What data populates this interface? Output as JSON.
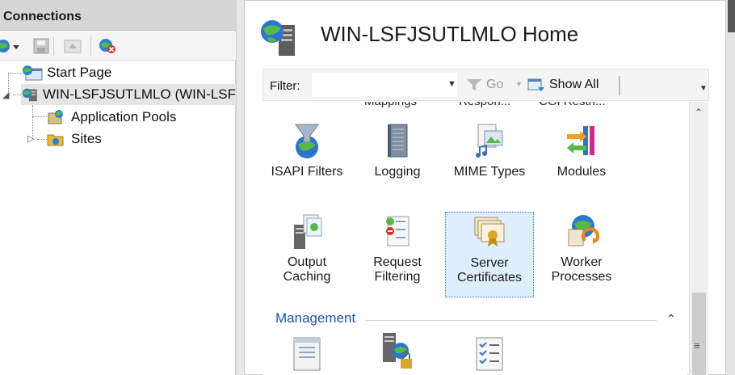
{
  "connections": {
    "header": "Connections",
    "tree": {
      "start_page": "Start Page",
      "server": "WIN-LSFJSUTLMLO (WIN-LSF",
      "app_pools": "Application Pools",
      "sites": "Sites"
    }
  },
  "home": {
    "title": "WIN-LSFJSUTLMLO Home"
  },
  "filter": {
    "label": "Filter:",
    "value": "",
    "go": "Go",
    "show_all": "Show All"
  },
  "features": {
    "cutoff": [
      "Mappings",
      "Respon...",
      "CGI Restri..."
    ],
    "row1": [
      {
        "label": "ISAPI Filters",
        "icon": "isapi-filters-icon"
      },
      {
        "label": "Logging",
        "icon": "logging-icon"
      },
      {
        "label": "MIME Types",
        "icon": "mime-types-icon"
      },
      {
        "label": "Modules",
        "icon": "modules-icon"
      }
    ],
    "row2": [
      {
        "line1": "Output",
        "line2": "Caching",
        "icon": "output-caching-icon"
      },
      {
        "line1": "Request",
        "line2": "Filtering",
        "icon": "request-filtering-icon"
      },
      {
        "line1": "Server",
        "line2": "Certificates",
        "icon": "server-certificates-icon"
      },
      {
        "line1": "Worker",
        "line2": "Processes",
        "icon": "worker-processes-icon"
      }
    ],
    "group": "Management"
  }
}
